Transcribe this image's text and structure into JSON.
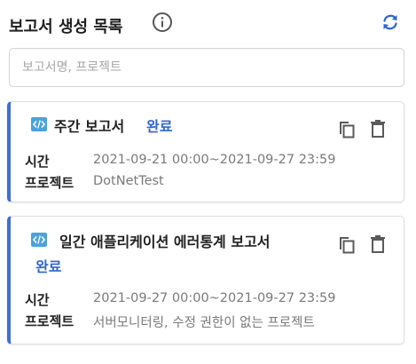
{
  "header": {
    "title": "보고서 생성 목록"
  },
  "search": {
    "placeholder": "보고서명, 프로젝트"
  },
  "reports": [
    {
      "title": "주간 보고서",
      "status": "완료",
      "time_label": "시간",
      "time_value": "2021-09-21 00:00~2021-09-27 23:59",
      "project_label": "프로젝트",
      "project_value": "DotNetTest"
    },
    {
      "title": "일간 애플리케이션 에러통계 보고서",
      "status": "완료",
      "time_label": "시간",
      "time_value": "2021-09-27 00:00~2021-09-27 23:59",
      "project_label": "프로젝트",
      "project_value": "서버모니터링, 수정 권한이 없는 프로젝트"
    }
  ],
  "colors": {
    "accent": "#3b6fd9",
    "status": "#2f66d0",
    "refresh": "#2f66d0",
    "code_icon": "#4aa3df"
  },
  "icons": [
    "info-icon",
    "refresh-icon",
    "code-icon",
    "copy-icon",
    "trash-icon"
  ]
}
